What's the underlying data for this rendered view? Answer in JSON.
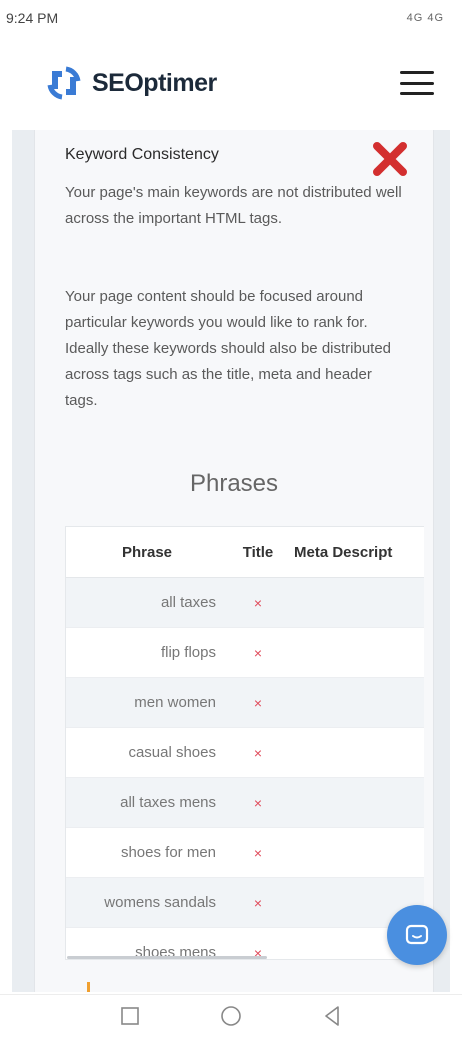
{
  "status_bar": {
    "time": "9:24 PM",
    "indicators": "4G 4G"
  },
  "header": {
    "logo_text": "SEOptimer",
    "menu_icon": "hamburger-icon",
    "brand_color": "#3a7bd5"
  },
  "section": {
    "title": "Keyword Consistency",
    "status_icon": "red-x-icon",
    "fail_color": "#d32f2f",
    "paragraph1": "Your page's main keywords are not distributed well across the important HTML tags.",
    "paragraph2": "Your page content should be focused around particular keywords you would like to rank for. Ideally these keywords should also be distributed across tags such as the title, meta and header tags."
  },
  "phrases": {
    "heading": "Phrases",
    "columns": [
      "Phrase",
      "Title",
      "Meta Descript"
    ],
    "mark": "×",
    "rows": [
      {
        "phrase": "all taxes",
        "title": "×",
        "meta": "×"
      },
      {
        "phrase": "flip flops",
        "title": "×",
        "meta": "×"
      },
      {
        "phrase": "men women",
        "title": "×",
        "meta": "×"
      },
      {
        "phrase": "casual shoes",
        "title": "×",
        "meta": "×"
      },
      {
        "phrase": "all taxes mens",
        "title": "×",
        "meta": "×"
      },
      {
        "phrase": "shoes for men",
        "title": "×",
        "meta": "×"
      },
      {
        "phrase": "womens sandals",
        "title": "×",
        "meta": "×"
      },
      {
        "phrase": "shoes mens",
        "title": "×",
        "meta": ""
      }
    ]
  },
  "chat": {
    "icon": "chat-icon",
    "color": "#4a8fe0"
  },
  "nav": {
    "recents": "square-icon",
    "home": "circle-icon",
    "back": "triangle-back-icon"
  }
}
